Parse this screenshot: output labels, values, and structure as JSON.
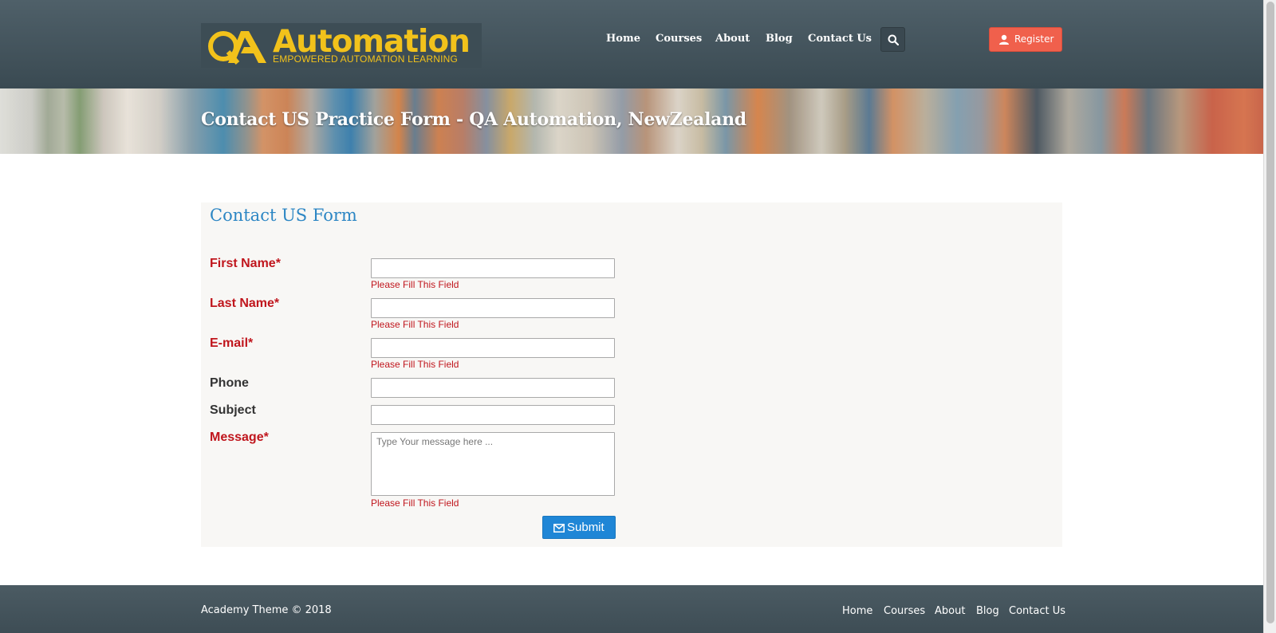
{
  "header": {
    "logo": {
      "word": "Automation",
      "tagline": "EMPOWERED AUTOMATION LEARNING",
      "mark": "QA"
    },
    "nav": [
      "Home",
      "Courses",
      "About",
      "Blog",
      "Contact Us"
    ],
    "search_icon": "search-icon",
    "register_label": "Register",
    "register_icon": "user-icon"
  },
  "banner": {
    "title": "Contact US Practice Form - QA Automation, NewZealand"
  },
  "form": {
    "title": "Contact US Form",
    "fields": [
      {
        "label": "First Name",
        "required_mark": "*",
        "value": "",
        "error": "Please Fill This Field"
      },
      {
        "label": "Last Name",
        "required_mark": "*",
        "value": "",
        "error": "Please Fill This Field"
      },
      {
        "label": "E-mail",
        "required_mark": "*",
        "value": "",
        "error": "Please Fill This Field"
      },
      {
        "label": "Phone",
        "value": ""
      },
      {
        "label": "Subject",
        "value": ""
      },
      {
        "label": "Message",
        "required_mark": "*",
        "placeholder": "Type Your message here ...",
        "value": "",
        "error": "Please Fill This Field"
      }
    ],
    "submit_label": "Submit",
    "submit_icon": "envelope-icon"
  },
  "footer": {
    "copyright": "Academy Theme © 2018",
    "links": [
      "Home",
      "Courses",
      "About",
      "Blog",
      "Contact Us"
    ]
  },
  "colors": {
    "header_bg": "#455760",
    "accent_title": "#2c86c4",
    "required_red": "#c0161d",
    "register_bg": "#f0604c",
    "submit_bg": "#1f86d6",
    "logo_yellow": "#f2c21b"
  }
}
